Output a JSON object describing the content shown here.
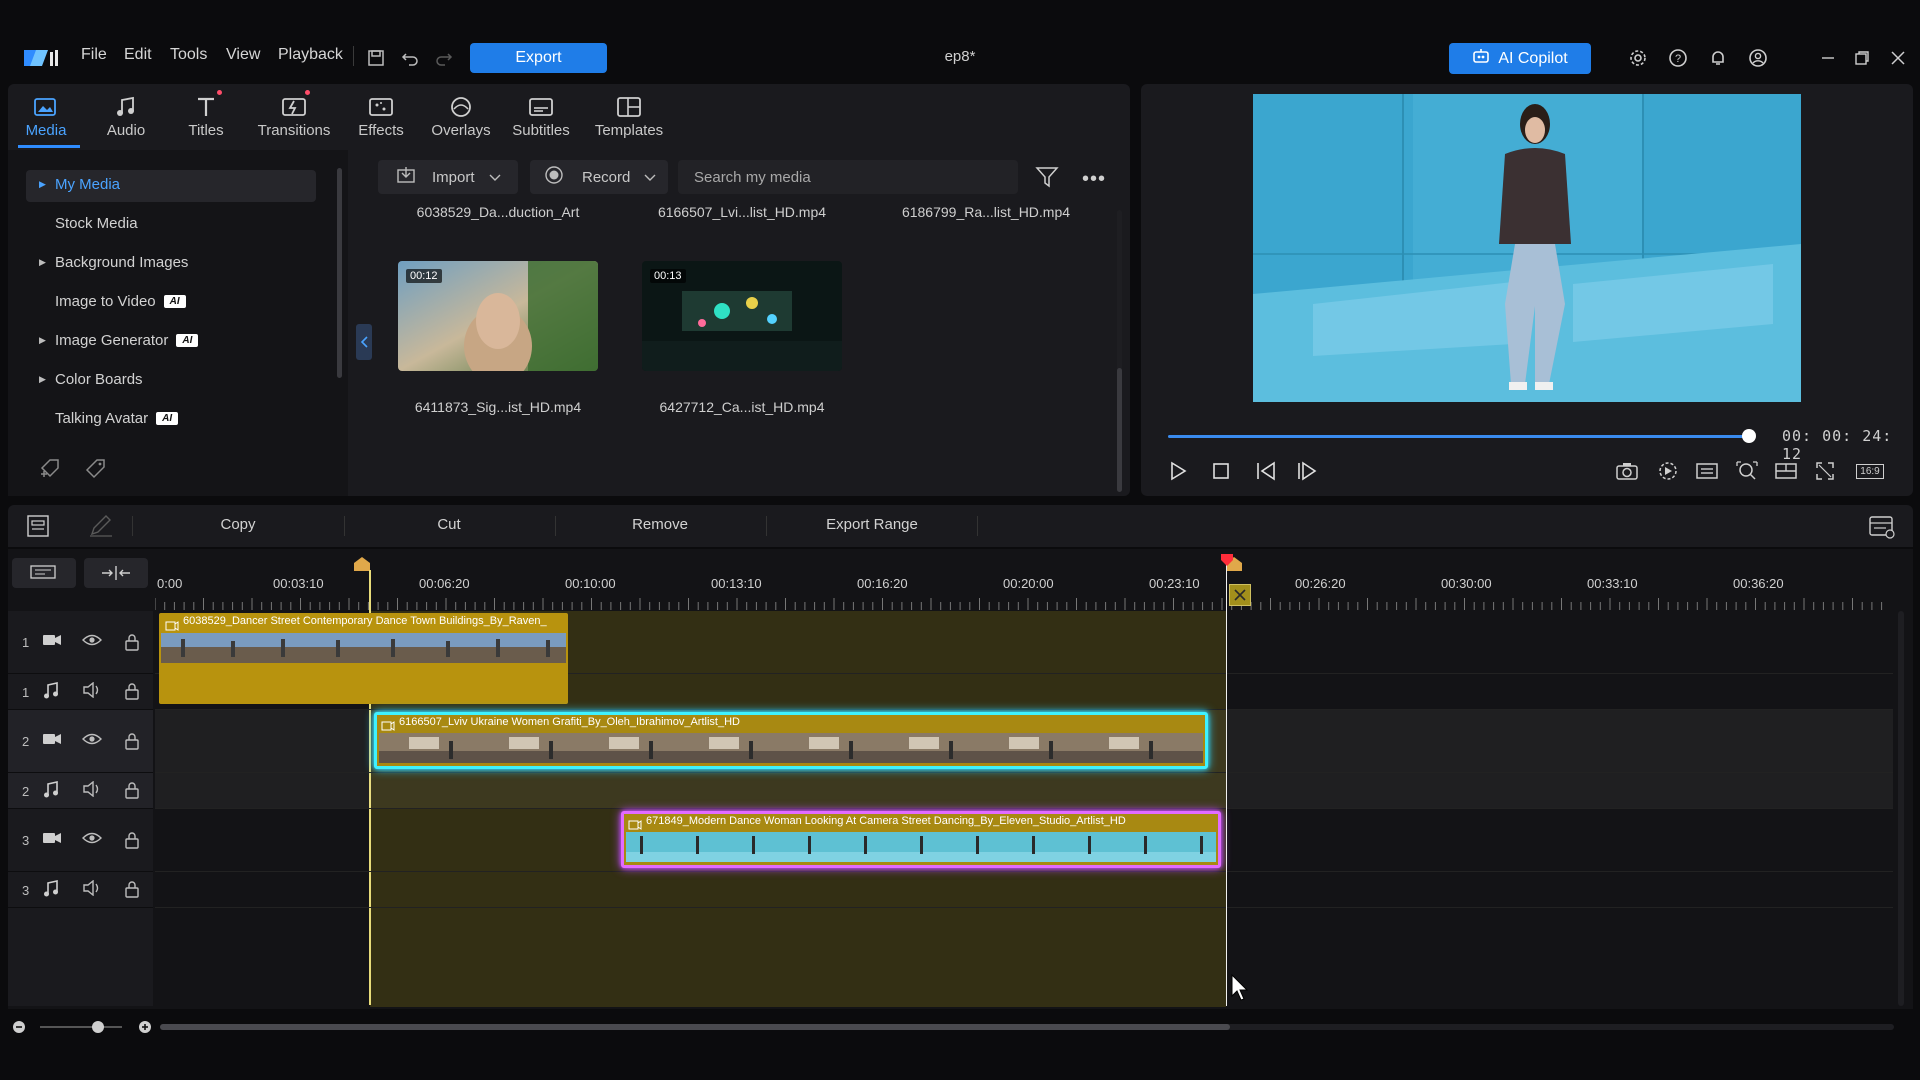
{
  "app": {
    "document_title": "ep8*",
    "menu": [
      "File",
      "Edit",
      "Tools",
      "View",
      "Playback"
    ],
    "export_label": "Export",
    "ai_copilot_label": "AI Copilot"
  },
  "library": {
    "tabs": [
      {
        "label": "Media",
        "icon": "media-icon",
        "active": true
      },
      {
        "label": "Audio",
        "icon": "music-note-icon"
      },
      {
        "label": "Titles",
        "icon": "text-icon",
        "dot": true
      },
      {
        "label": "Transitions",
        "icon": "transition-icon",
        "dot": true
      },
      {
        "label": "Effects",
        "icon": "effects-icon"
      },
      {
        "label": "Overlays",
        "icon": "overlay-icon"
      },
      {
        "label": "Subtitles",
        "icon": "subtitle-icon"
      },
      {
        "label": "Templates",
        "icon": "template-icon"
      }
    ],
    "tree": [
      {
        "label": "My Media",
        "expandable": true,
        "active": true
      },
      {
        "label": "Stock Media"
      },
      {
        "label": "Background Images",
        "expandable": true
      },
      {
        "label": "Image to Video",
        "ai": true
      },
      {
        "label": "Image Generator",
        "expandable": true,
        "ai": true
      },
      {
        "label": "Color Boards",
        "expandable": true
      },
      {
        "label": "Talking Avatar",
        "ai": true
      }
    ],
    "ai_badge": "AI",
    "import_label": "Import",
    "record_label": "Record",
    "search_placeholder": "Search my media",
    "media": [
      {
        "name": "6038529_Da...duction_Art"
      },
      {
        "name": "6166507_Lvi...list_HD.mp4"
      },
      {
        "name": "6186799_Ra...list_HD.mp4"
      },
      {
        "name": "6411873_Sig...ist_HD.mp4",
        "duration": "00:12"
      },
      {
        "name": "6427712_Ca...ist_HD.mp4",
        "duration": "00:13"
      }
    ]
  },
  "preview": {
    "timecode": "00: 00: 24: 12",
    "progress": 0.97,
    "aspect_label": "16:9"
  },
  "edit_toolbar": {
    "copy": "Copy",
    "cut": "Cut",
    "remove": "Remove",
    "export_range": "Export Range"
  },
  "timeline": {
    "ruler": [
      "0:00",
      "00:03:10",
      "00:06:20",
      "00:10:00",
      "00:13:10",
      "00:16:20",
      "00:20:00",
      "00:23:10",
      "00:26:20",
      "00:30:00",
      "00:33:10",
      "00:36:20"
    ],
    "tracks": [
      {
        "num": "1",
        "type": "video"
      },
      {
        "num": "1",
        "type": "audio"
      },
      {
        "num": "2",
        "type": "video"
      },
      {
        "num": "2",
        "type": "audio"
      },
      {
        "num": "3",
        "type": "video"
      },
      {
        "num": "3",
        "type": "audio"
      }
    ],
    "clips": [
      {
        "track": 1,
        "label": "6038529_Dancer Street Contemporary Dance Town Buildings_By_Raven_"
      },
      {
        "track": 2,
        "label": "6166507_Lviv Ukraine Women Grafiti_By_Oleh_Ibrahimov_Artlist_HD"
      },
      {
        "track": 3,
        "label": "671849_Modern Dance Woman Looking At Camera Street Dancing_By_Eleven_Studio_Artlist_HD"
      }
    ]
  }
}
